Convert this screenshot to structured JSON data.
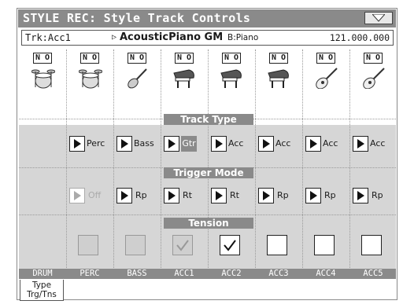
{
  "title": "STYLE REC: Style Track Controls",
  "info": {
    "track": "Trk:Acc1",
    "arrow": "▷",
    "sound": "AcousticPiano GM",
    "bank": "B:Piano",
    "position": "121.000.000"
  },
  "tracks": [
    {
      "name": "DRUM",
      "icon": "drum-kit-icon",
      "mute": "N O",
      "type": "",
      "mode": "",
      "tension": ""
    },
    {
      "name": "PERC",
      "icon": "drum-kit-icon",
      "mute": "N O",
      "type": "Perc",
      "mode": "Off",
      "tension": "unchecked-dim"
    },
    {
      "name": "BASS",
      "icon": "electric-guitar-icon",
      "mute": "N O",
      "type": "Bass",
      "mode": "Rp",
      "tension": "unchecked-dim"
    },
    {
      "name": "ACC1",
      "icon": "grand-piano-icon",
      "mute": "N O",
      "type": "Gtr",
      "mode": "Rt",
      "tension": "checked-dim"
    },
    {
      "name": "ACC2",
      "icon": "grand-piano-icon",
      "mute": "N O",
      "type": "Acc",
      "mode": "Rt",
      "tension": "checked"
    },
    {
      "name": "ACC3",
      "icon": "grand-piano-icon",
      "mute": "N O",
      "type": "Acc",
      "mode": "Rp",
      "tension": "unchecked"
    },
    {
      "name": "ACC4",
      "icon": "acoustic-guitar-icon",
      "mute": "N O",
      "type": "Acc",
      "mode": "Rp",
      "tension": "unchecked"
    },
    {
      "name": "ACC5",
      "icon": "acoustic-guitar-icon",
      "mute": "N O",
      "type": "Acc",
      "mode": "Rp",
      "tension": "unchecked"
    }
  ],
  "sections": {
    "track_type": "Track Type",
    "trigger_mode": "Trigger Mode",
    "tension": "Tension"
  },
  "tab": {
    "line1": "Type",
    "line2": "Trg/Tns"
  }
}
